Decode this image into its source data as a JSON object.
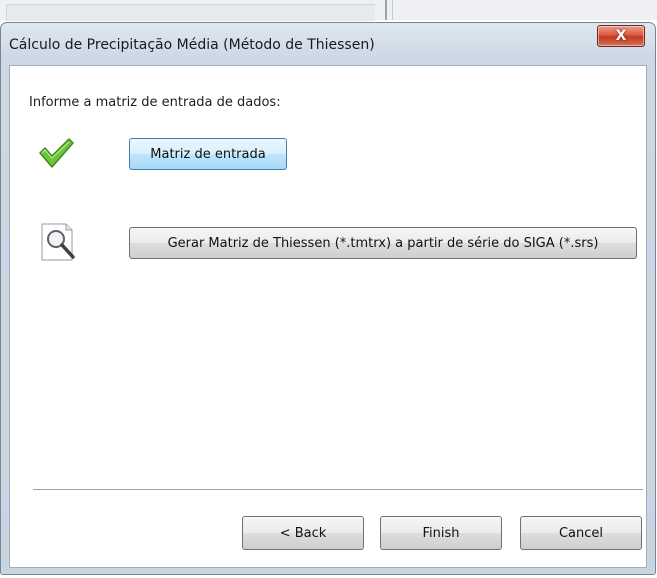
{
  "window": {
    "title": "Cálculo de Precipitação Média (Método de Thiessen)",
    "close_label": "X"
  },
  "content": {
    "prompt": "Informe a matriz de entrada de dados:",
    "status_icon": "check-icon",
    "matriz_button": "Matriz de entrada",
    "generate_icon": "magnifier-icon",
    "generate_button": "Gerar Matriz de Thiessen (*.tmtrx) a partir de série do SIGA (*.srs)"
  },
  "footer": {
    "back_label": "< Back",
    "finish_label": "Finish",
    "cancel_label": "Cancel"
  },
  "colors": {
    "check_green": "#5cb82e",
    "close_red": "#c23a20",
    "focus_blue": "#3c7fb1"
  }
}
